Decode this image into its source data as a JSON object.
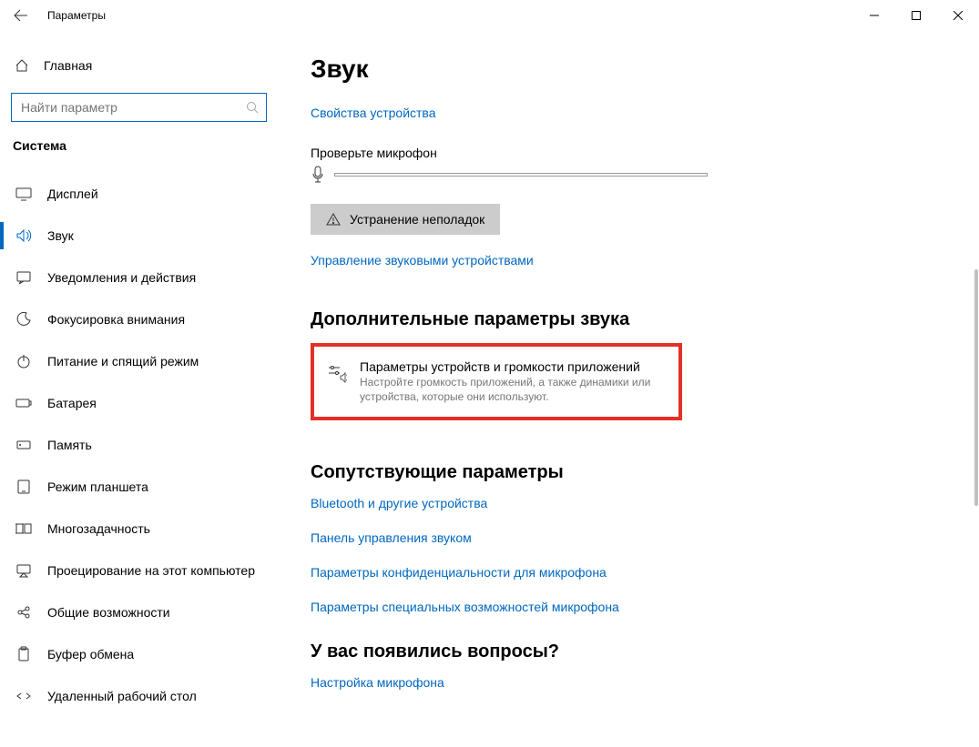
{
  "window": {
    "title": "Параметры"
  },
  "sidebar": {
    "home": "Главная",
    "search_placeholder": "Найти параметр",
    "category": "Система",
    "items": [
      {
        "label": "Дисплей"
      },
      {
        "label": "Звук"
      },
      {
        "label": "Уведомления и действия"
      },
      {
        "label": "Фокусировка внимания"
      },
      {
        "label": "Питание и спящий режим"
      },
      {
        "label": "Батарея"
      },
      {
        "label": "Память"
      },
      {
        "label": "Режим планшета"
      },
      {
        "label": "Многозадачность"
      },
      {
        "label": "Проецирование на этот компьютер"
      },
      {
        "label": "Общие возможности"
      },
      {
        "label": "Буфер обмена"
      },
      {
        "label": "Удаленный рабочий стол"
      }
    ]
  },
  "page": {
    "title": "Звук",
    "device_props_link": "Свойства устройства",
    "test_mic_label": "Проверьте микрофон",
    "troubleshoot_btn": "Устранение неполадок",
    "manage_devices_link": "Управление звуковыми устройствами",
    "advanced_heading": "Дополнительные параметры звука",
    "card_title": "Параметры устройств и громкости приложений",
    "card_desc": "Настройте громкость приложений, а также динамики или устройства, которые они используют.",
    "related_heading": "Сопутствующие параметры",
    "related_links": [
      "Bluetooth и другие устройства",
      "Панель управления звуком",
      "Параметры конфиденциальности для микрофона",
      "Параметры специальных возможностей микрофона"
    ],
    "questions_heading": "У вас появились вопросы?",
    "mic_setup_link": "Настройка микрофона"
  }
}
